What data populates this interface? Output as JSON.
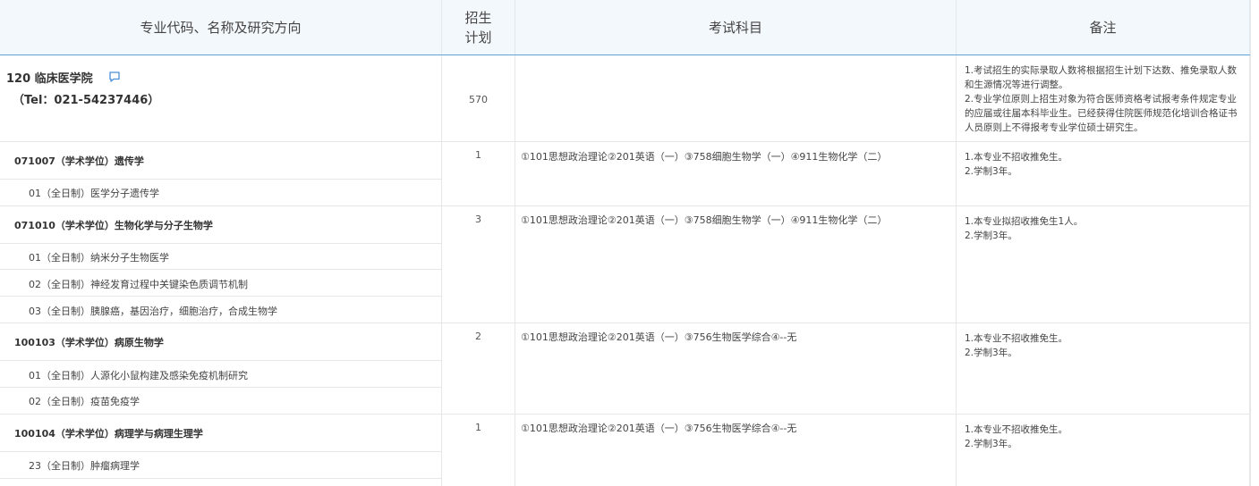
{
  "header": {
    "col_major": "专业代码、名称及研究方向",
    "col_plan_line1": "招生",
    "col_plan_line2": "计划",
    "col_subjects": "考试科目",
    "col_notes": "备注"
  },
  "college": {
    "name": "120 临床医学院",
    "tel": "（Tel：021-54237446）",
    "plan": "570",
    "notes": "1.考试招生的实际录取人数将根据招生计划下达数、推免录取人数和生源情况等进行调整。\n2.专业学位原则上招生对象为符合医师资格考试报考条件规定专业的应届或往届本科毕业生。已经获得住院医师规范化培训合格证书人员原则上不得报考专业学位硕士研究生。"
  },
  "majors": [
    {
      "title": "071007（学术学位）遗传学",
      "plan": "1",
      "subjects": "①101思想政治理论②201英语（一）③758细胞生物学（一）④911生物化学（二）",
      "notes": "1.本专业不招收推免生。\n2.学制3年。",
      "directions": [
        "01（全日制）医学分子遗传学"
      ]
    },
    {
      "title": "071010（学术学位）生物化学与分子生物学",
      "plan": "3",
      "subjects": "①101思想政治理论②201英语（一）③758细胞生物学（一）④911生物化学（二）",
      "notes": "1.本专业拟招收推免生1人。\n2.学制3年。",
      "directions": [
        "01（全日制）纳米分子生物医学",
        "02（全日制）神经发育过程中关键染色质调节机制",
        "03（全日制）胰腺癌，基因治疗，细胞治疗，合成生物学"
      ]
    },
    {
      "title": "100103（学术学位）病原生物学",
      "plan": "2",
      "subjects": "①101思想政治理论②201英语（一）③756生物医学综合④--无",
      "notes": "1.本专业不招收推免生。\n2.学制3年。",
      "directions": [
        "01（全日制）人源化小鼠构建及感染免疫机制研究",
        "02（全日制）疫苗免疫学"
      ]
    },
    {
      "title": "100104（学术学位）病理学与病理生理学",
      "plan": "1",
      "subjects": "①101思想政治理论②201英语（一）③756生物医学综合④--无",
      "notes": "1.本专业不招收推免生。\n2.学制3年。",
      "directions": [
        "23（全日制）肿瘤病理学"
      ]
    }
  ],
  "colors": {
    "header_bg": "#f3f8fd",
    "header_line": "#5fa3dc",
    "icon": "#4a90d9"
  }
}
